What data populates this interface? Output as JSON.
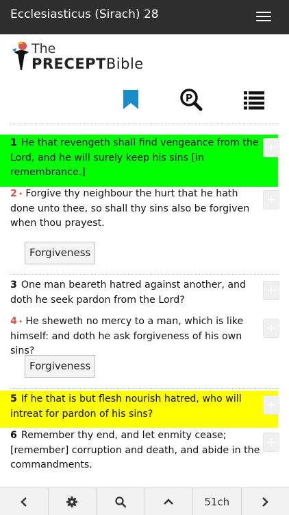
{
  "header": {
    "title": "Ecclesiasticus (Sirach) 28",
    "menu_icon": "hamburger-menu-icon"
  },
  "logo": {
    "line1": "The",
    "precept": "PRECEPT",
    "bible": "Bible"
  },
  "toolbar": {
    "bookmark_icon": "bookmark-icon",
    "precept_search_icon": "precept-search-icon",
    "list_icon": "list-icon",
    "bookmark_color": "#1a8cc8"
  },
  "verses": [
    {
      "number": "1",
      "text": "He that revengeth shall find vengeance from the Lord, and he will surely keep his sins [in remembrance.]",
      "highlight": "#00ff00"
    },
    {
      "number": "2",
      "text": "Forgive thy neighbour the hurt that he hath done unto thee, so shall thy sins also be forgiven when thou prayest.",
      "tag": "Forgiveness"
    },
    {
      "number": "3",
      "text": "One man beareth hatred against another, and doth he seek pardon from the Lord?"
    },
    {
      "number": "4",
      "text": "He sheweth no mercy to a man, which is like himself: and doth he ask forgiveness of his own sins?",
      "tag": "Forgiveness"
    },
    {
      "number": "5",
      "text": "If he that is but flesh nourish hatred, who will intreat for pardon of his sins?",
      "highlight": "#ffff00"
    },
    {
      "number": "6",
      "text": "Remember thy end, and let enmity cease; [remember] corruption and death, and abide in the commandments."
    }
  ],
  "verse_dot": "•",
  "plus_label": "+",
  "bottom_bar": {
    "prev_icon": "chevron-left-icon",
    "settings_icon": "gear-icon",
    "search_icon": "search-icon",
    "up_icon": "chevron-up-icon",
    "chapters_label": "51ch",
    "next_icon": "chevron-right-icon"
  }
}
